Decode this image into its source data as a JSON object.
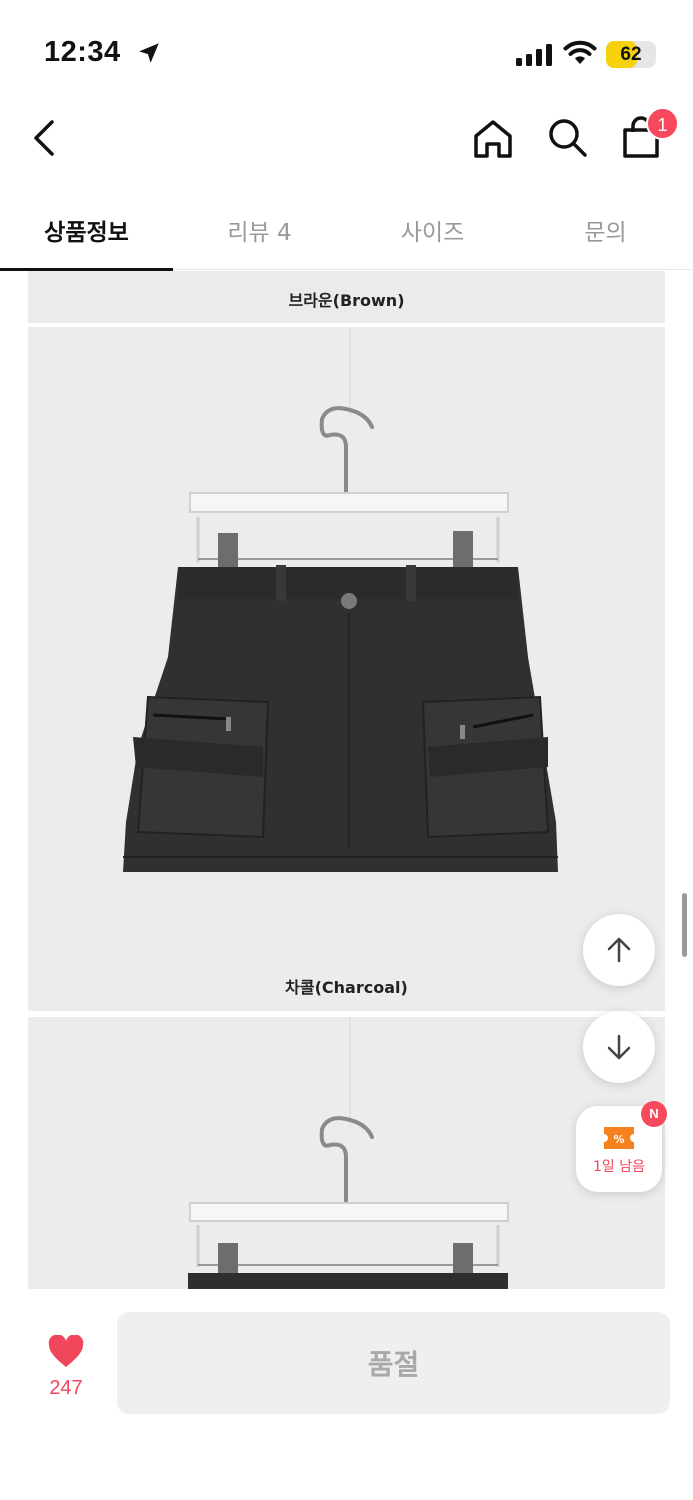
{
  "status_bar": {
    "time": "12:34",
    "battery_percent": "62",
    "battery_level": 0.62,
    "icons": [
      "location-arrow-icon",
      "signal-icon",
      "wifi-icon",
      "battery-icon"
    ]
  },
  "header": {
    "icons": [
      "back-icon",
      "home-icon",
      "search-icon",
      "cart-icon"
    ],
    "cart_badge_count": "1"
  },
  "tabs": [
    {
      "label": "상품정보",
      "active": true
    },
    {
      "label": "리뷰 4",
      "active": false
    },
    {
      "label": "사이즈",
      "active": false
    },
    {
      "label": "문의",
      "active": false
    }
  ],
  "product_images": [
    {
      "caption": "브라운(Brown)"
    },
    {
      "caption": "차콜(Charcoal)"
    },
    {
      "caption": ""
    }
  ],
  "floating": {
    "scroll_up_icon": "arrow-up-icon",
    "scroll_down_icon": "arrow-down-icon",
    "coupon_icon": "coupon-ticket-icon",
    "coupon_label": "1일 남음",
    "new_badge": "N"
  },
  "bottom_bar": {
    "like_icon": "heart-icon",
    "like_count": "247",
    "soldout_label": "품절"
  },
  "colors": {
    "accent": "#f0465c",
    "badge": "#f8485e",
    "battery": "#f5d20c"
  }
}
